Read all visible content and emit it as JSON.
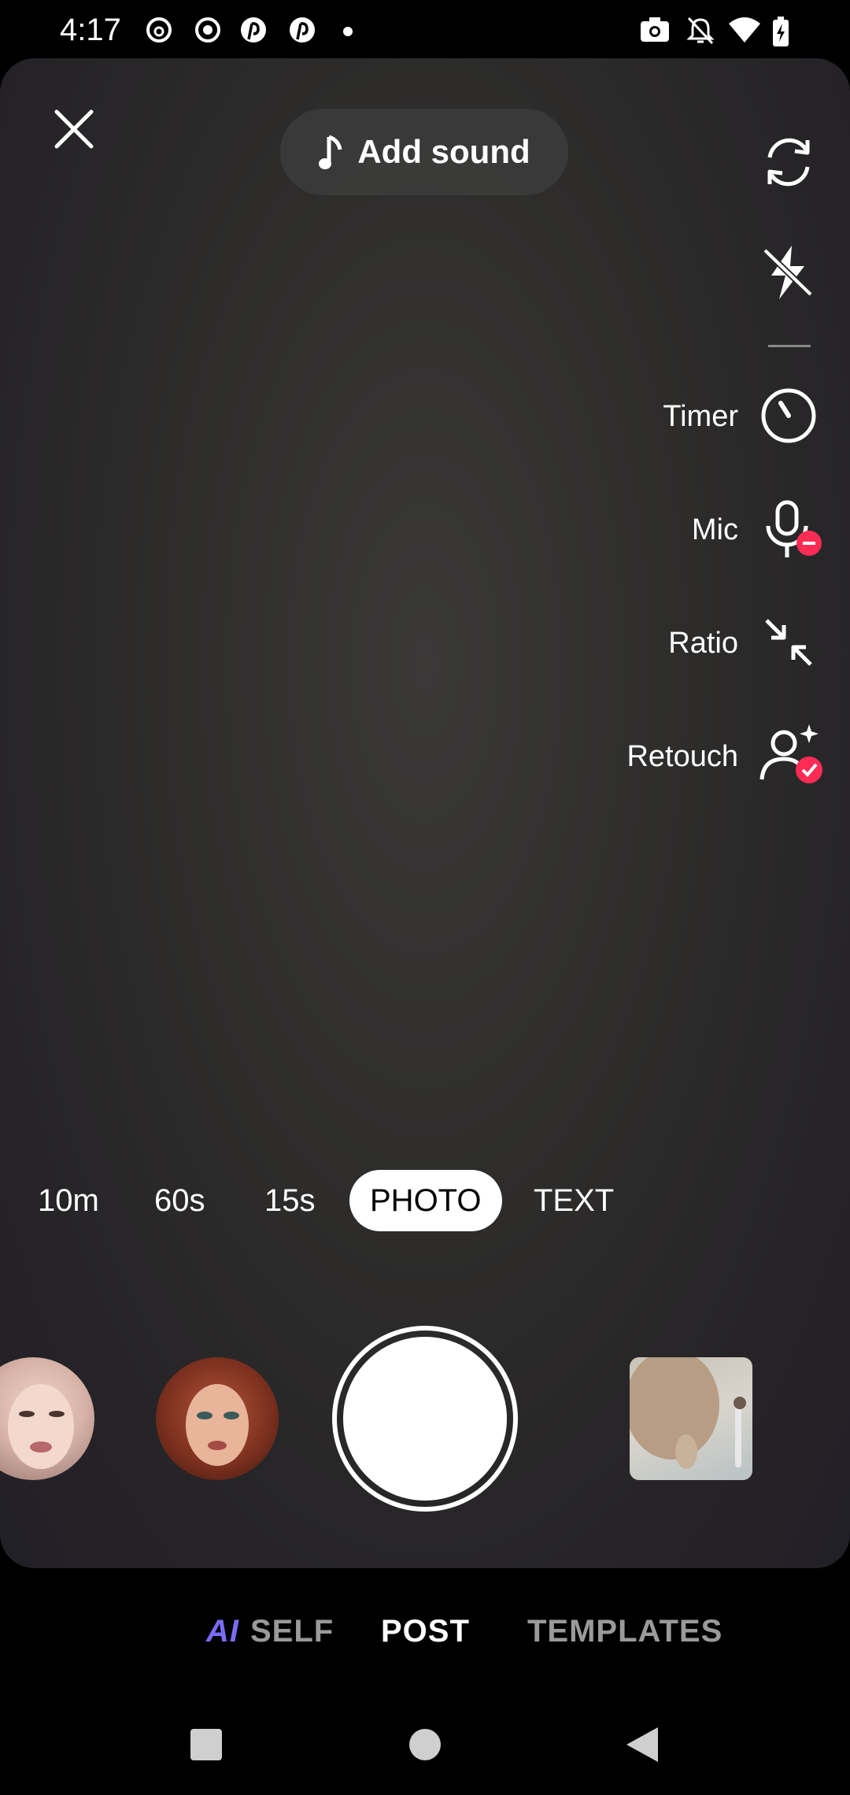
{
  "status_bar": {
    "time": "4:17",
    "left_icons": [
      "threads-icon",
      "record-icon",
      "pinterest-icon",
      "pinterest-icon",
      "dot-icon"
    ],
    "right_icons": [
      "screenshot-icon",
      "bell-off-icon",
      "wifi-icon",
      "battery-charging-icon"
    ]
  },
  "top_bar": {
    "close_icon": "close-icon",
    "add_sound_label": "Add sound",
    "note_icon": "music-note-icon"
  },
  "side_tools": {
    "flip_icon": "flip-camera-icon",
    "flash_icon": "flash-off-icon",
    "items": [
      {
        "label": "Timer",
        "icon": "timer-icon"
      },
      {
        "label": "Mic",
        "icon": "mic-off-icon"
      },
      {
        "label": "Ratio",
        "icon": "ratio-icon"
      },
      {
        "label": "Retouch",
        "icon": "retouch-icon"
      }
    ]
  },
  "capture_modes": {
    "items": [
      "10m",
      "60s",
      "15s",
      "PHOTO",
      "TEXT"
    ],
    "selected": "PHOTO"
  },
  "effects": {
    "left_effect": "face-effect-1",
    "right_effect": "face-effect-2",
    "gallery_thumbnail": "gallery-thumbnail"
  },
  "bottom_tabs": {
    "ai_prefix": "AI",
    "ai_suffix": "SELF",
    "post": "POST",
    "templates": "TEMPLATES"
  },
  "colors": {
    "accent_ai": "#7b6cf6",
    "badge_red": "#fe2c55",
    "inactive_tab": "#9a9a9a"
  },
  "nav_bar": {
    "icons": [
      "recents-icon",
      "home-icon",
      "back-icon"
    ]
  }
}
